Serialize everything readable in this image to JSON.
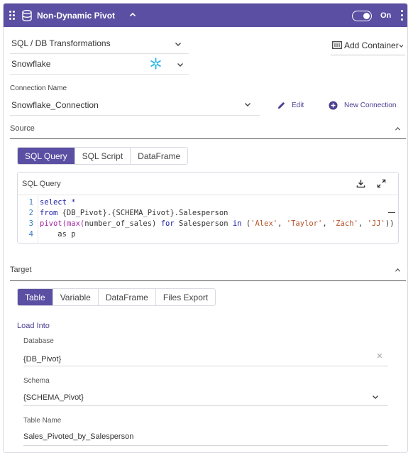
{
  "header": {
    "title": "Non-Dynamic Pivot",
    "toggle_label": "On",
    "accent": "#5b4fa3"
  },
  "transformation_select": {
    "value": "SQL / DB Transformations"
  },
  "platform_select": {
    "value": "Snowflake",
    "icon": "snowflake-icon"
  },
  "add_container": {
    "label": "Add Container"
  },
  "connection": {
    "label": "Connection Name",
    "value": "Snowflake_Connection",
    "edit_label": "Edit",
    "new_label": "New Connection"
  },
  "source": {
    "title": "Source",
    "tabs": [
      "SQL Query",
      "SQL Script",
      "DataFrame"
    ],
    "active_tab": "SQL Query",
    "editor_title": "SQL Query",
    "code_lines": [
      {
        "num": "1",
        "tokens": [
          {
            "t": "select *",
            "c": "kw"
          }
        ]
      },
      {
        "num": "2",
        "tokens": [
          {
            "t": "from ",
            "c": "kw"
          },
          {
            "t": "{DB_Pivot}.{SCHEMA_Pivot}.Salesperson",
            "c": "id"
          }
        ]
      },
      {
        "num": "3",
        "tokens": [
          {
            "t": "pivot(",
            "c": "fn"
          },
          {
            "t": "max(",
            "c": "fn"
          },
          {
            "t": "number_of_sales) ",
            "c": "id"
          },
          {
            "t": "for ",
            "c": "kw"
          },
          {
            "t": "Salesperson ",
            "c": "id"
          },
          {
            "t": "in ",
            "c": "kw"
          },
          {
            "t": "(",
            "c": "id"
          },
          {
            "t": "'Alex'",
            "c": "str"
          },
          {
            "t": ", ",
            "c": "id"
          },
          {
            "t": "'Taylor'",
            "c": "str"
          },
          {
            "t": ", ",
            "c": "id"
          },
          {
            "t": "'Zach'",
            "c": "str"
          },
          {
            "t": ", ",
            "c": "id"
          },
          {
            "t": "'JJ'",
            "c": "str"
          },
          {
            "t": "))",
            "c": "id"
          }
        ]
      },
      {
        "num": "4",
        "tokens": [
          {
            "t": "    as p",
            "c": "id"
          }
        ]
      }
    ]
  },
  "target": {
    "title": "Target",
    "tabs": [
      "Table",
      "Variable",
      "DataFrame",
      "Files Export"
    ],
    "active_tab": "Table",
    "load_into": "Load Into",
    "database": {
      "label": "Database",
      "value": "{DB_Pivot}"
    },
    "schema": {
      "label": "Schema",
      "value": "{SCHEMA_Pivot}"
    },
    "table_name": {
      "label": "Table Name",
      "value": "Sales_Pivoted_by_Salesperson"
    }
  }
}
